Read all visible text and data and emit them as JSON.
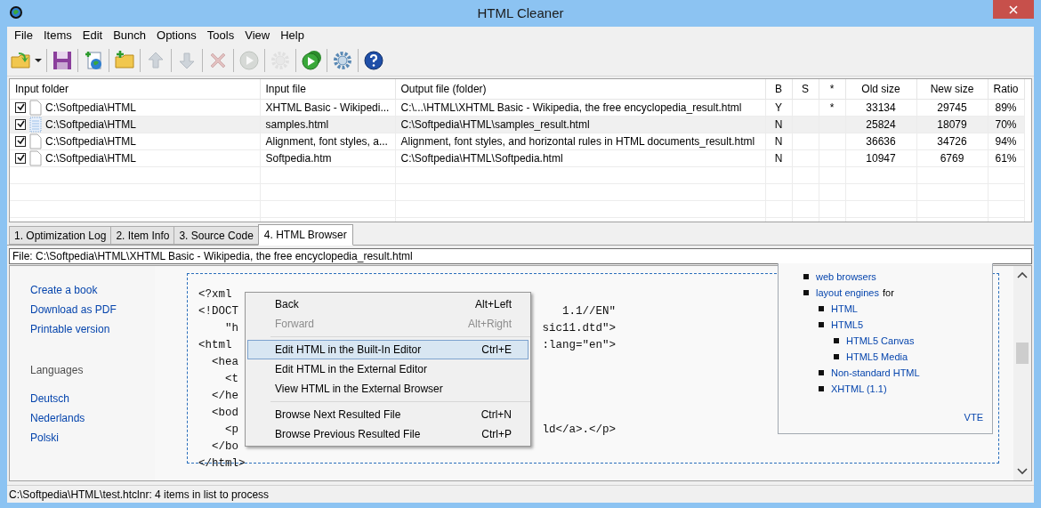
{
  "window": {
    "title": "HTML Cleaner"
  },
  "menu": [
    "File",
    "Items",
    "Edit",
    "Bunch",
    "Options",
    "Tools",
    "View",
    "Help"
  ],
  "toolbar": [
    {
      "kind": "open",
      "disabled": false
    },
    {
      "kind": "dropdown",
      "disabled": false
    },
    {
      "kind": "save",
      "disabled": false
    },
    {
      "kind": "add-web",
      "disabled": false
    },
    {
      "kind": "add-folder",
      "disabled": false
    },
    {
      "kind": "up",
      "disabled": true
    },
    {
      "kind": "down",
      "disabled": true
    },
    {
      "kind": "delete",
      "disabled": true
    },
    {
      "kind": "play",
      "disabled": true
    },
    {
      "kind": "gear",
      "disabled": true
    },
    {
      "kind": "play-all",
      "disabled": false
    },
    {
      "kind": "settings",
      "disabled": false
    },
    {
      "kind": "help",
      "disabled": false
    }
  ],
  "table": {
    "columns": [
      "Input folder",
      "Input file",
      "Output file (folder)",
      "B",
      "S",
      "*",
      "Old size",
      "New size",
      "Ratio"
    ],
    "rows": [
      {
        "checked": true,
        "selected": false,
        "kind": "page",
        "cells": [
          "C:\\Softpedia\\HTML",
          "XHTML Basic - Wikipedi...",
          "C:\\...\\HTML\\XHTML Basic - Wikipedia, the free encyclopedia_result.html",
          "Y",
          null,
          "*",
          "33134",
          "29745",
          "89%"
        ]
      },
      {
        "checked": true,
        "selected": true,
        "kind": "grid",
        "cells": [
          "C:\\Softpedia\\HTML",
          "samples.html",
          "C:\\Softpedia\\HTML\\samples_result.html",
          "N",
          null,
          null,
          "25824",
          "18079",
          "70%"
        ]
      },
      {
        "checked": true,
        "selected": false,
        "kind": "page",
        "cells": [
          "C:\\Softpedia\\HTML",
          "Alignment, font styles, a...",
          "Alignment, font styles, and horizontal rules in HTML documents_result.html",
          "N",
          null,
          null,
          "36636",
          "34726",
          "94%"
        ]
      },
      {
        "checked": true,
        "selected": false,
        "kind": "page",
        "cells": [
          "C:\\Softpedia\\HTML",
          "Softpedia.htm",
          "C:\\Softpedia\\HTML\\Softpedia.html",
          "N",
          null,
          null,
          "10947",
          "6769",
          "61%"
        ]
      }
    ]
  },
  "tabs": [
    {
      "label": "1. Optimization Log",
      "selected": false
    },
    {
      "label": "2. Item Info",
      "selected": false
    },
    {
      "label": "3. Source Code",
      "selected": false
    },
    {
      "label": "4. HTML Browser",
      "selected": true
    }
  ],
  "file_field": {
    "value": "File: C:\\Softpedia\\HTML\\XHTML Basic - Wikipedia, the free encyclopedia_result.html"
  },
  "browser": {
    "nav_links": [
      "Create a book",
      "Download as PDF",
      "Printable version"
    ],
    "languages_heading": "Languages",
    "language_links": [
      "Deutsch",
      "Nederlands",
      "Polski"
    ],
    "code_lines": [
      {
        "left": "<?xml"
      },
      {
        "left": "<!DOCT",
        "right": "1.1//EN\""
      },
      {
        "left": "    \"h",
        "right": "sic11.dtd\">"
      },
      {
        "left": "<html",
        "right": ":lang=\"en\">"
      },
      {
        "left": "  <hea"
      },
      {
        "left": "    <t"
      },
      {
        "left": "  </he"
      },
      {
        "left": "  <bod"
      },
      {
        "left": "    <p",
        "right": "ld</a>.</p>"
      },
      {
        "left": "  </bo"
      },
      {
        "left": "</html>"
      }
    ],
    "infobox": {
      "items": [
        {
          "link": "web browsers"
        },
        {
          "link": "layout engines",
          "suffix": "for",
          "children": [
            {
              "link": "HTML"
            },
            {
              "link": "HTML5",
              "children": [
                {
                  "link": "HTML5 Canvas"
                },
                {
                  "link": "HTML5 Media"
                }
              ]
            },
            {
              "link": "Non-standard HTML"
            },
            {
              "link": "XHTML (1.1)"
            }
          ]
        }
      ],
      "footer": "VTE"
    }
  },
  "context_menu": [
    {
      "kind": "item",
      "label": "Back",
      "shortcut": "Alt+Left",
      "disabled": false,
      "selected": false
    },
    {
      "kind": "item",
      "label": "Forward",
      "shortcut": "Alt+Right",
      "disabled": true,
      "selected": false
    },
    {
      "kind": "separator"
    },
    {
      "kind": "item",
      "label": "Edit HTML in the Built-In Editor",
      "shortcut": "Ctrl+E",
      "disabled": false,
      "selected": true
    },
    {
      "kind": "item",
      "label": "Edit HTML in the External Editor",
      "disabled": false,
      "selected": false
    },
    {
      "kind": "item",
      "label": "View HTML in the External Browser",
      "disabled": false,
      "selected": false
    },
    {
      "kind": "separator"
    },
    {
      "kind": "item",
      "label": "Browse Next Resulted File",
      "shortcut": "Ctrl+N",
      "disabled": false,
      "selected": false
    },
    {
      "kind": "item",
      "label": "Browse Previous Resulted File",
      "shortcut": "Ctrl+P",
      "disabled": false,
      "selected": false
    }
  ],
  "status_bar": "C:\\Softpedia\\HTML\\test.htclnr: 4 items in list to process"
}
